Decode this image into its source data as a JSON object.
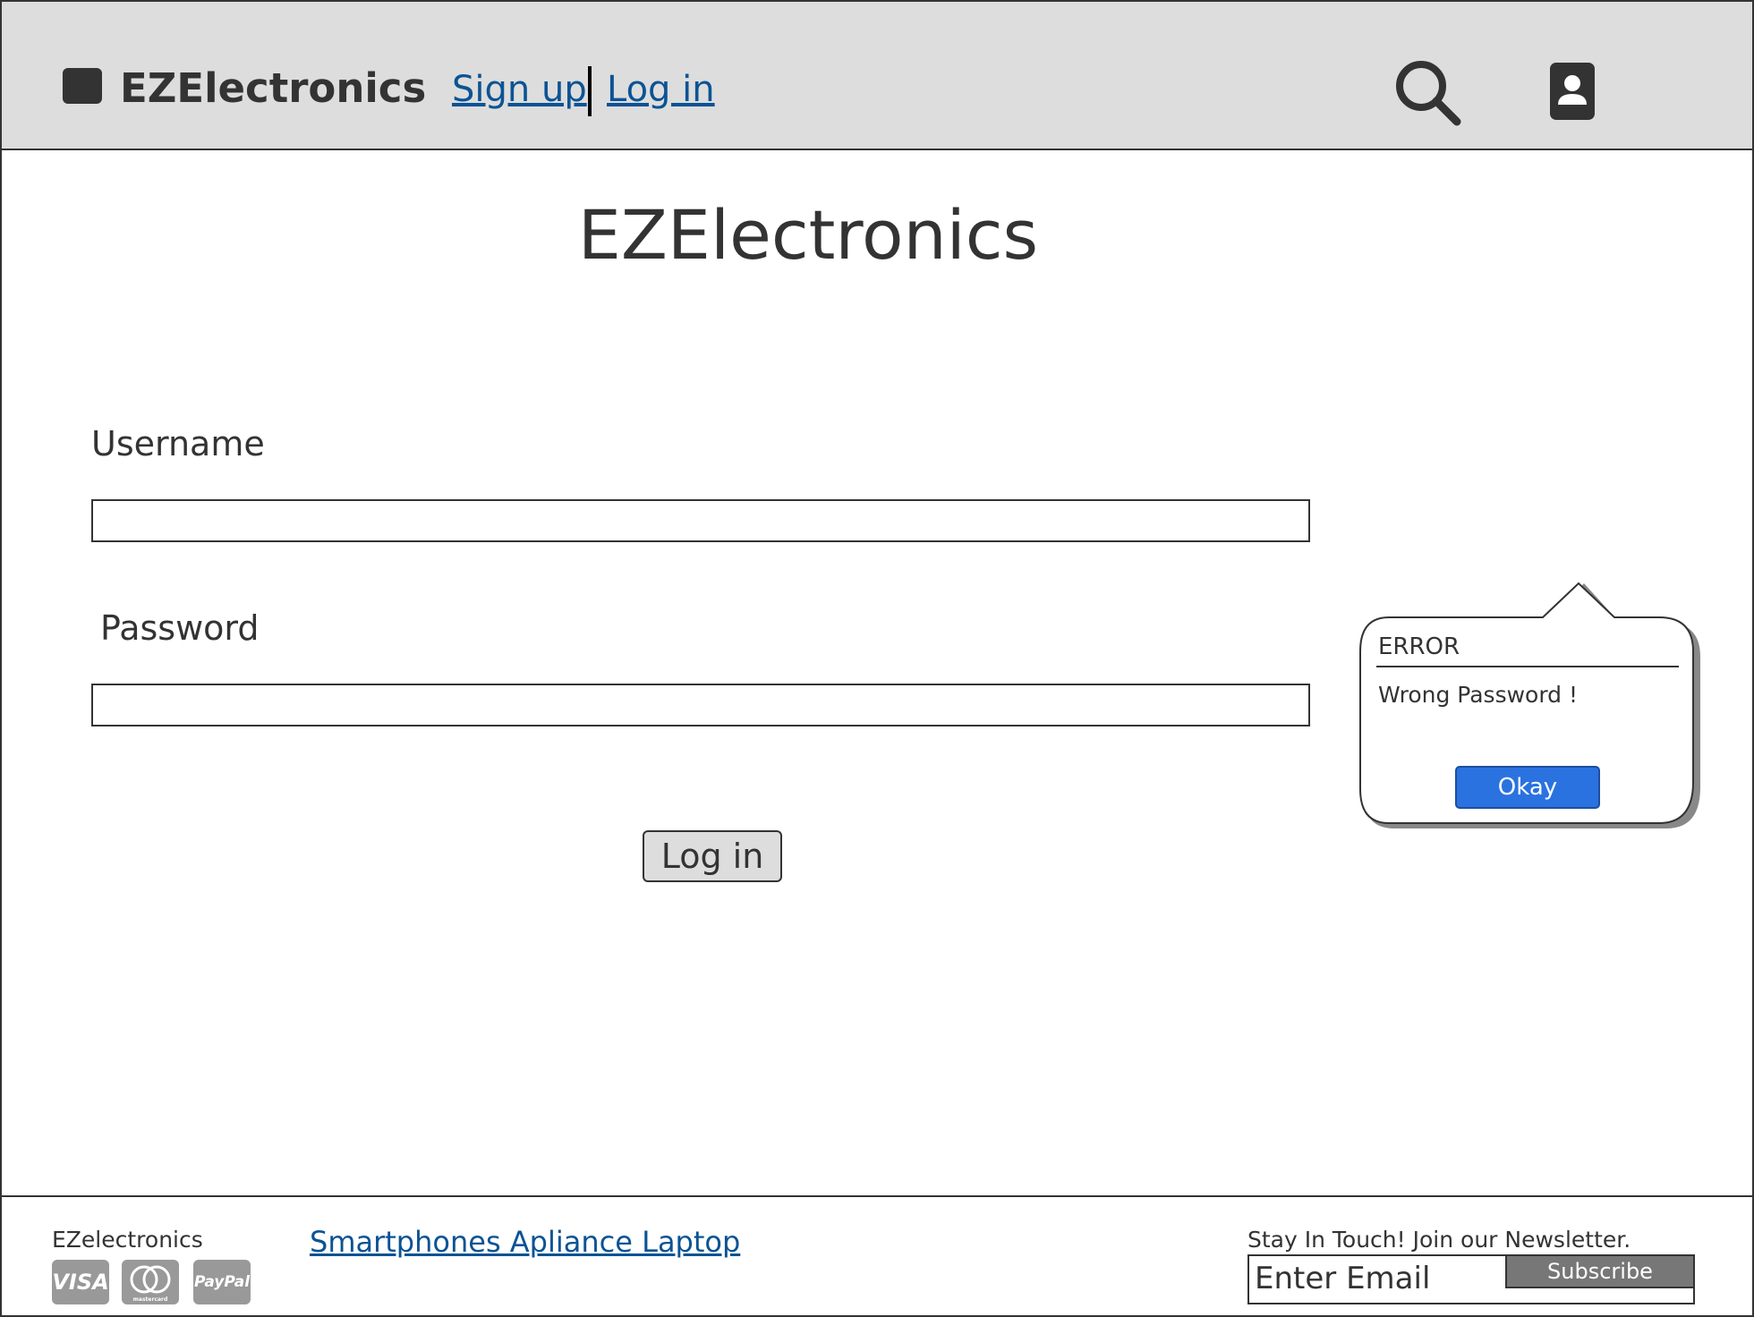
{
  "header": {
    "brand": "EZElectronics",
    "signup_label": "Sign up",
    "login_label": "Log in",
    "search_icon": "search-icon",
    "user_icon": "user-icon"
  },
  "main": {
    "title": "EZElectronics",
    "username_label": "Username",
    "username_value": "",
    "password_label": "Password",
    "password_value": "",
    "login_button": "Log in"
  },
  "error_dialog": {
    "title": "ERROR",
    "message": "Wrong Password !",
    "okay_label": "Okay"
  },
  "footer": {
    "brand": "EZelectronics",
    "payment_methods": [
      "VISA",
      "mastercard",
      "PayPal"
    ],
    "links": "Smartphones Apliance Laptop",
    "newsletter_label": "Stay In Touch! Join our Newsletter.",
    "email_placeholder": "Enter Email",
    "subscribe_label": "Subscribe"
  },
  "colors": {
    "header_bg": "#dddddd",
    "link": "#0b5394",
    "primary_button": "#2a72e0",
    "text": "#333333"
  }
}
